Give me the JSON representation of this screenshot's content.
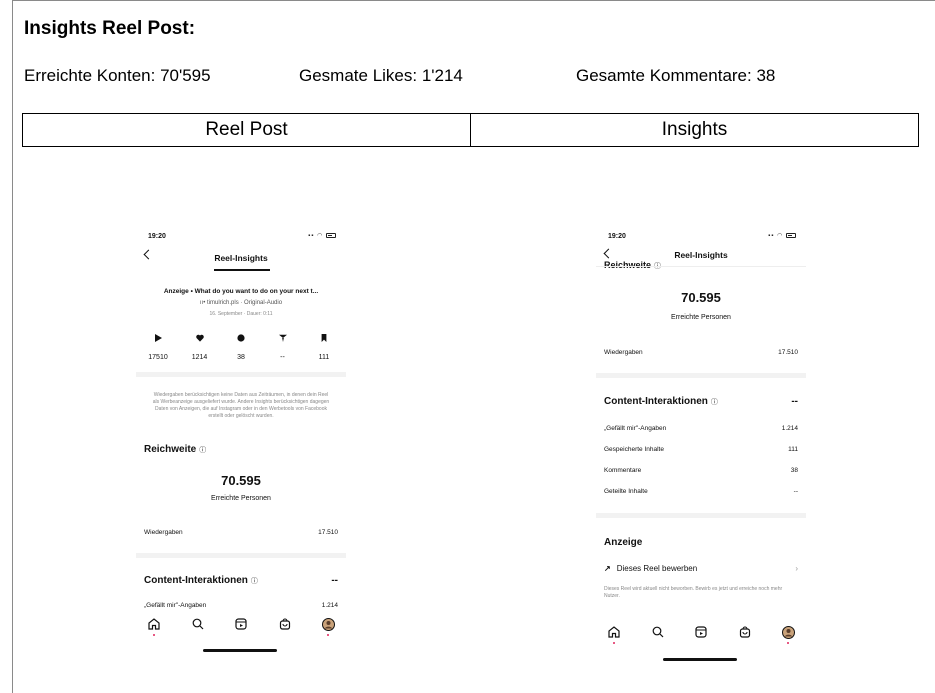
{
  "document": {
    "title": "Insights Reel Post:",
    "stats": {
      "reached_accounts": "Erreichte Konten: 70'595",
      "total_likes": "Gesmate Likes: 1'214",
      "total_comments": "Gesamte Kommentare: 38"
    },
    "table_headers": [
      "Reel Post",
      "Insights"
    ]
  },
  "left_phone": {
    "time": "19:20",
    "page_title": "Reel-Insights",
    "ad_line": "Anzeige • What do you want to do on your next t...",
    "audio_line": "timulrich.pls · Original-Audio",
    "date_line": "16. September · Dauer: 0:11",
    "metrics": [
      {
        "icon": "play-icon",
        "value": "17510"
      },
      {
        "icon": "heart-icon",
        "value": "1214"
      },
      {
        "icon": "comment-icon",
        "value": "38"
      },
      {
        "icon": "share-icon",
        "value": "--"
      },
      {
        "icon": "bookmark-icon",
        "value": "111"
      }
    ],
    "disclaimer": "Wiedergaben berücksichtigen keine Daten aus Zeiträumen, in denen dein Reel als Werbeanzeige ausgeliefert wurde. Andere Insights berücksichtigen dagegen Daten von Anzeigen, die auf Instagram oder in den Werbetools von Facebook erstellt oder gelöscht wurden.",
    "reach_title": "Reichweite",
    "reach_value": "70.595",
    "reach_label": "Erreichte Personen",
    "views_label": "Wiedergaben",
    "views_value": "17.510",
    "interactions_title": "Content-Interaktionen",
    "interactions_value": "--",
    "likes_label": "„Gefällt mir\"-Angaben",
    "likes_value": "1.214"
  },
  "right_phone": {
    "time": "19:20",
    "page_title": "Reel-Insights",
    "reach_title": "Reichweite",
    "reach_value": "70.595",
    "reach_label": "Erreichte Personen",
    "views_label": "Wiedergaben",
    "views_value": "17.510",
    "interactions_title": "Content-Interaktionen",
    "interactions_value": "--",
    "rows": [
      {
        "label": "„Gefällt mir\"-Angaben",
        "value": "1.214"
      },
      {
        "label": "Gespeicherte Inhalte",
        "value": "111"
      },
      {
        "label": "Kommentare",
        "value": "38"
      },
      {
        "label": "Geteilte Inhalte",
        "value": "--"
      }
    ],
    "ad_title": "Anzeige",
    "promote_label": "Dieses Reel bewerben",
    "promote_note": "Dieses Reel wird aktuell nicht beworben. Bewirb es jetzt und erreiche noch mehr Nutzer."
  },
  "colors": {
    "notification_dot": "#e0245e",
    "separator": "#f2f2f2"
  }
}
